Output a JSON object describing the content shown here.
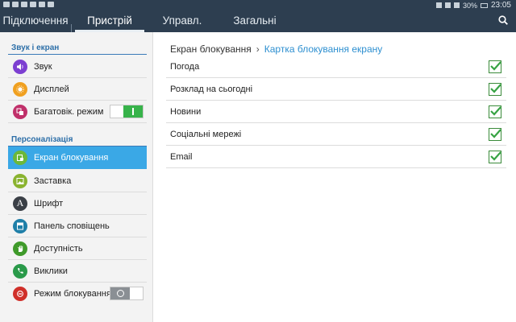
{
  "status": {
    "time": "23:05",
    "battery": "30%"
  },
  "tabs": [
    {
      "label": "Підключення",
      "active": false
    },
    {
      "label": "Пристрій",
      "active": true
    },
    {
      "label": "Управл.",
      "active": false
    },
    {
      "label": "Загальні",
      "active": false
    }
  ],
  "sidebar": {
    "sections": [
      {
        "title": "Звук і екран"
      },
      {
        "title": "Персоналізація"
      }
    ],
    "items": [
      {
        "label": "Звук",
        "icon": "speaker-icon",
        "color": "#7c3fd1"
      },
      {
        "label": "Дисплей",
        "icon": "brightness-icon",
        "color": "#f0a020"
      },
      {
        "label": "Багатовік. режим",
        "icon": "multiwindow-icon",
        "color": "#c0306a",
        "toggle": "on"
      },
      {
        "label": "Екран блокування",
        "icon": "lockscreen-icon",
        "color": "#6cb83a",
        "active": true
      },
      {
        "label": "Заставка",
        "icon": "wallpaper-icon",
        "color": "#8ab32f"
      },
      {
        "label": "Шрифт",
        "icon": "font-icon",
        "color": "#3a3f46"
      },
      {
        "label": "Панель сповіщень",
        "icon": "notification-panel-icon",
        "color": "#1f7fa8"
      },
      {
        "label": "Доступність",
        "icon": "hand-icon",
        "color": "#3f9a2a"
      },
      {
        "label": "Виклики",
        "icon": "phone-icon",
        "color": "#2a9a4a"
      },
      {
        "label": "Режим блокування",
        "icon": "blocking-mode-icon",
        "color": "#d0302a",
        "toggle": "off"
      }
    ]
  },
  "main": {
    "breadcrumb": {
      "parent": "Екран блокування",
      "current": "Картка блокування екрану"
    },
    "rows": [
      {
        "label": "Погода",
        "checked": true
      },
      {
        "label": "Розклад на сьогодні",
        "checked": true
      },
      {
        "label": "Новини",
        "checked": true
      },
      {
        "label": "Соціальні мережі",
        "checked": true
      },
      {
        "label": "Email",
        "checked": true
      }
    ]
  },
  "colors": {
    "topbar": "#2d3e50",
    "accent": "#3aa8e6",
    "check": "#37a344",
    "section": "#2d6fa8"
  }
}
